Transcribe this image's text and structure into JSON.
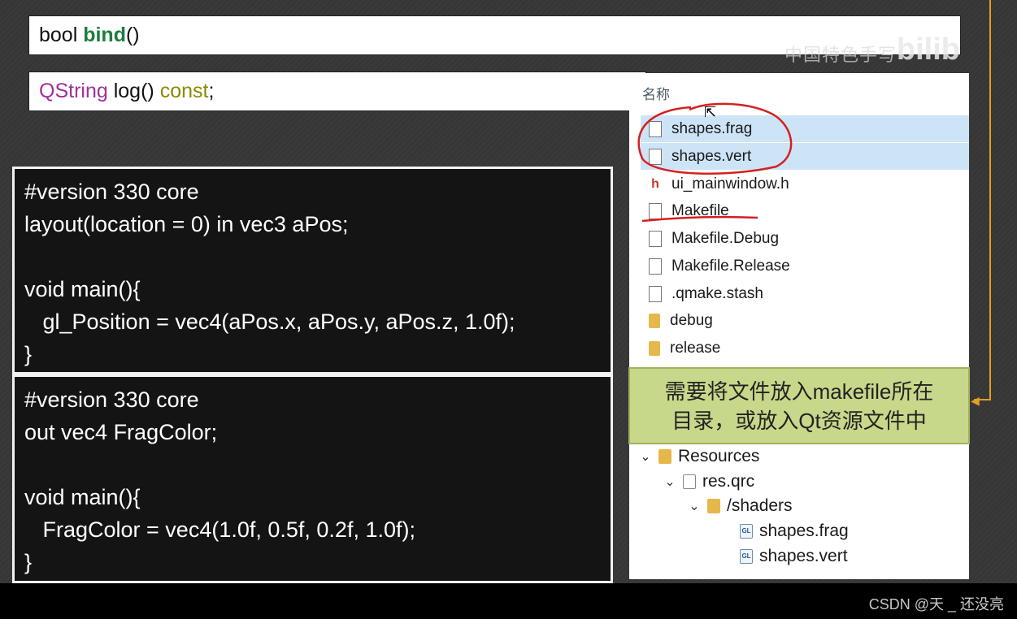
{
  "signatures": {
    "bind": {
      "type": "bool",
      "name": "bind",
      "args": "()"
    },
    "log": {
      "type": "QString",
      "name": "log()",
      "qualifier": "const",
      "end": ";"
    }
  },
  "watermark": {
    "text": "中国特色手写",
    "logo": "bilib"
  },
  "vertex_shader": {
    "lines": [
      "#version 330 core",
      "layout(location = 0) in vec3 aPos;",
      "",
      "void main(){",
      "   gl_Position = vec4(aPos.x, aPos.y, aPos.z, 1.0f);",
      "}"
    ]
  },
  "fragment_shader": {
    "lines": [
      "#version 330 core",
      "out vec4 FragColor;",
      "",
      "void main(){",
      "   FragColor = vec4(1.0f, 0.5f, 0.2f, 1.0f);",
      "}"
    ]
  },
  "explorer": {
    "column_header": "名称",
    "files": [
      {
        "name": "shapes.frag",
        "icon": "file-icon",
        "selected": true
      },
      {
        "name": "shapes.vert",
        "icon": "file-icon",
        "selected": true
      },
      {
        "name": "ui_mainwindow.h",
        "icon": "header-file-icon",
        "selected": false
      },
      {
        "name": "Makefile",
        "icon": "file-icon",
        "selected": false
      },
      {
        "name": "Makefile.Debug",
        "icon": "file-icon",
        "selected": false
      },
      {
        "name": "Makefile.Release",
        "icon": "file-icon",
        "selected": false
      },
      {
        "name": ".qmake.stash",
        "icon": "file-icon",
        "selected": false
      },
      {
        "name": "debug",
        "icon": "folder-icon",
        "selected": false
      },
      {
        "name": "release",
        "icon": "folder-icon",
        "selected": false
      }
    ]
  },
  "callout": {
    "line1": "需要将文件放入makefile所在",
    "line2": "目录，或放入Qt资源文件中"
  },
  "resource_tree": {
    "root": "Resources",
    "qrc": "res.qrc",
    "prefix": "/shaders",
    "files": [
      "shapes.frag",
      "shapes.vert"
    ]
  },
  "footer": {
    "credit": "CSDN @天 _ 还没亮"
  },
  "colors": {
    "accent_orange": "#e0a020",
    "selection_blue": "#cde4f7",
    "callout_green": "#c7d88a",
    "annotation_red": "#d42020"
  }
}
